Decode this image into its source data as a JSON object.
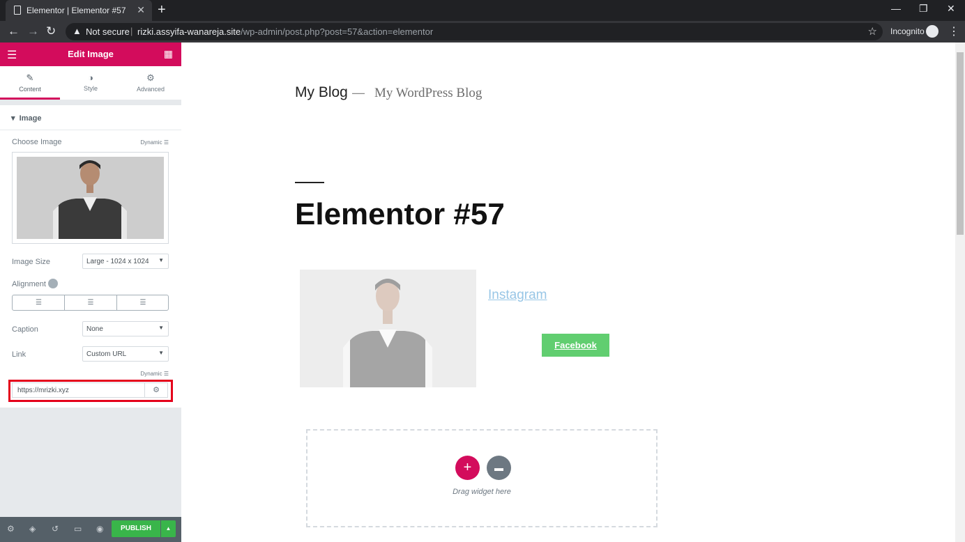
{
  "browser": {
    "tab_title": "Elementor | Elementor #57",
    "tab_close": "✕",
    "new_tab": "+",
    "window_controls": [
      "—",
      "❐",
      "✕"
    ],
    "nav": {
      "back": "←",
      "forward": "→",
      "reload": "↻"
    },
    "security_label": "Not secure",
    "url_host": "rizki.assyifa-wanareja.site",
    "url_path": "/wp-admin/post.php?post=57&action=elementor",
    "incognito_label": "Incognito",
    "menu": "⋮"
  },
  "panel": {
    "header_title": "Edit Image",
    "tabs": [
      {
        "label": "Content",
        "icon": "pencil-icon"
      },
      {
        "label": "Style",
        "icon": "contrast-icon"
      },
      {
        "label": "Advanced",
        "icon": "gear-icon"
      }
    ],
    "section_title": "Image",
    "choose_image_label": "Choose Image",
    "dynamic_label": "Dynamic",
    "image_size_label": "Image Size",
    "image_size_value": "Large - 1024 x 1024",
    "alignment_label": "Alignment",
    "caption_label": "Caption",
    "caption_value": "None",
    "link_label": "Link",
    "link_value": "Custom URL",
    "link_dynamic_label": "Dynamic",
    "url_value": "https://mrizki.xyz",
    "publish_label": "PUBLISH"
  },
  "preview": {
    "site_title": "My Blog",
    "site_dash": "—",
    "site_tagline": "My WordPress Blog",
    "post_title": "Elementor #57",
    "instagram_link": "Instagram",
    "facebook_button": "Facebook",
    "drag_text": "Drag widget here"
  },
  "colors": {
    "elementor_pink": "#d30c5c",
    "publish_green": "#39b54a",
    "facebook_green": "#61ce70",
    "highlight_red": "#e4001b"
  }
}
